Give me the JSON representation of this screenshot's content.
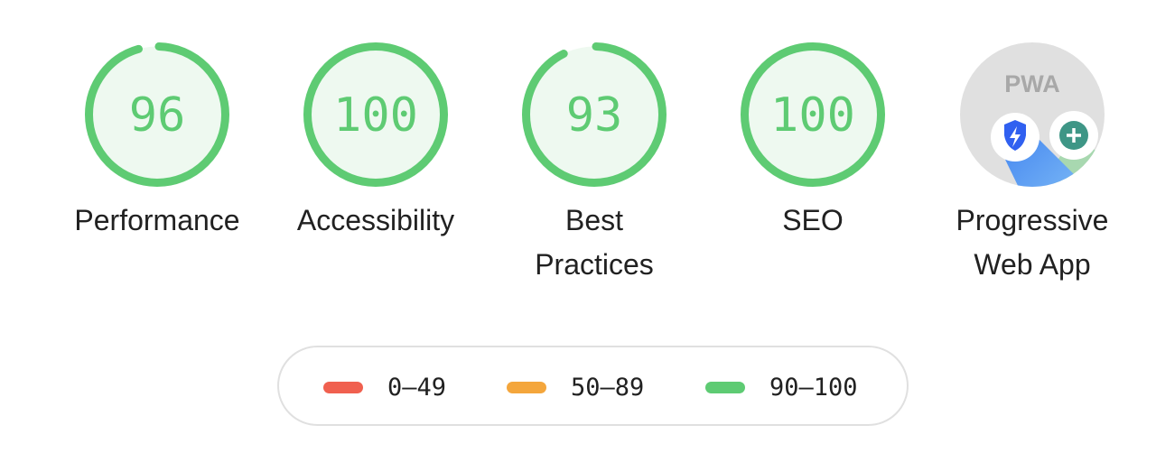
{
  "categories": [
    {
      "label": "Performance",
      "score": 96
    },
    {
      "label": "Accessibility",
      "score": 100
    },
    {
      "label": "Best Practices",
      "score": 93
    },
    {
      "label": "SEO",
      "score": 100
    },
    {
      "label": "Progressive Web App",
      "badge": "PWA",
      "icon": "pwa-badge-icon"
    }
  ],
  "legend": [
    {
      "range": "0–49",
      "color": "#f0604f"
    },
    {
      "range": "50–89",
      "color": "#f4a63c"
    },
    {
      "range": "90–100",
      "color": "#5ecb73"
    }
  ],
  "colors": {
    "pass": "#5ecb73",
    "pass_bg": "#eef9f0",
    "pwa_bg": "#e0e0e0"
  }
}
